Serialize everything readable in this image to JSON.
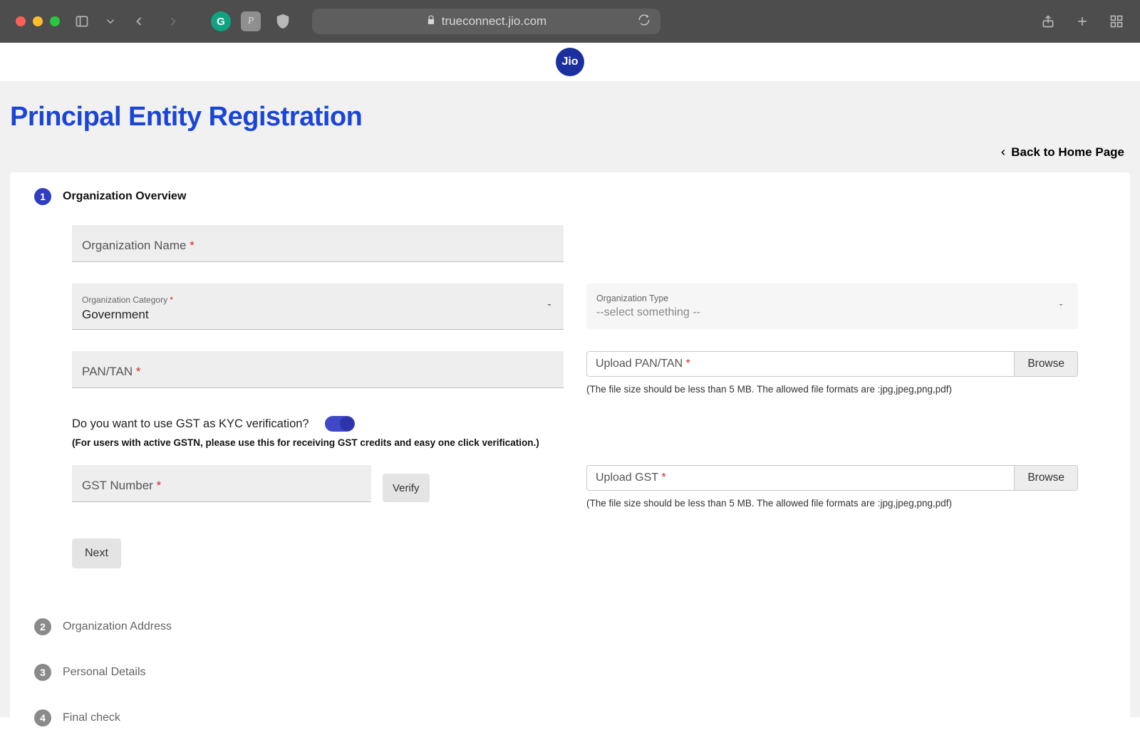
{
  "browser": {
    "url_display": "trueconnect.jio.com"
  },
  "brand": {
    "logo_text": "Jio"
  },
  "page": {
    "title": "Principal Entity Registration",
    "back_link": "Back to Home Page"
  },
  "steps": [
    {
      "num": "1",
      "label": "Organization Overview",
      "active": true
    },
    {
      "num": "2",
      "label": "Organization Address",
      "active": false
    },
    {
      "num": "3",
      "label": "Personal Details",
      "active": false
    },
    {
      "num": "4",
      "label": "Final check",
      "active": false
    }
  ],
  "form": {
    "org_name": {
      "label": "Organization Name",
      "required": true,
      "value": ""
    },
    "org_category": {
      "label": "Organization Category",
      "required": true,
      "value": "Government"
    },
    "org_type": {
      "label": "Organization Type",
      "placeholder": "--select something --"
    },
    "pan_tan": {
      "label": "PAN/TAN",
      "required": true,
      "value": ""
    },
    "upload_pan": {
      "placeholder": "Upload PAN/TAN",
      "required": true,
      "browse_label": "Browse",
      "helper": "(The file size should be less than 5 MB. The allowed file formats are :jpg,jpeg,png,pdf)"
    },
    "gst_kyc_question": "Do you want to use GST as KYC verification?",
    "gst_kyc_note": "(For users with active GSTN, please use this for receiving GST credits and easy one click verification.)",
    "gst_toggle_on": true,
    "gst_number": {
      "label": "GST Number",
      "required": true,
      "value": ""
    },
    "verify_label": "Verify",
    "upload_gst": {
      "placeholder": "Upload GST",
      "required": true,
      "browse_label": "Browse",
      "helper": "(The file size should be less than 5 MB. The allowed file formats are :jpg,jpeg,png,pdf)"
    },
    "next_label": "Next"
  }
}
